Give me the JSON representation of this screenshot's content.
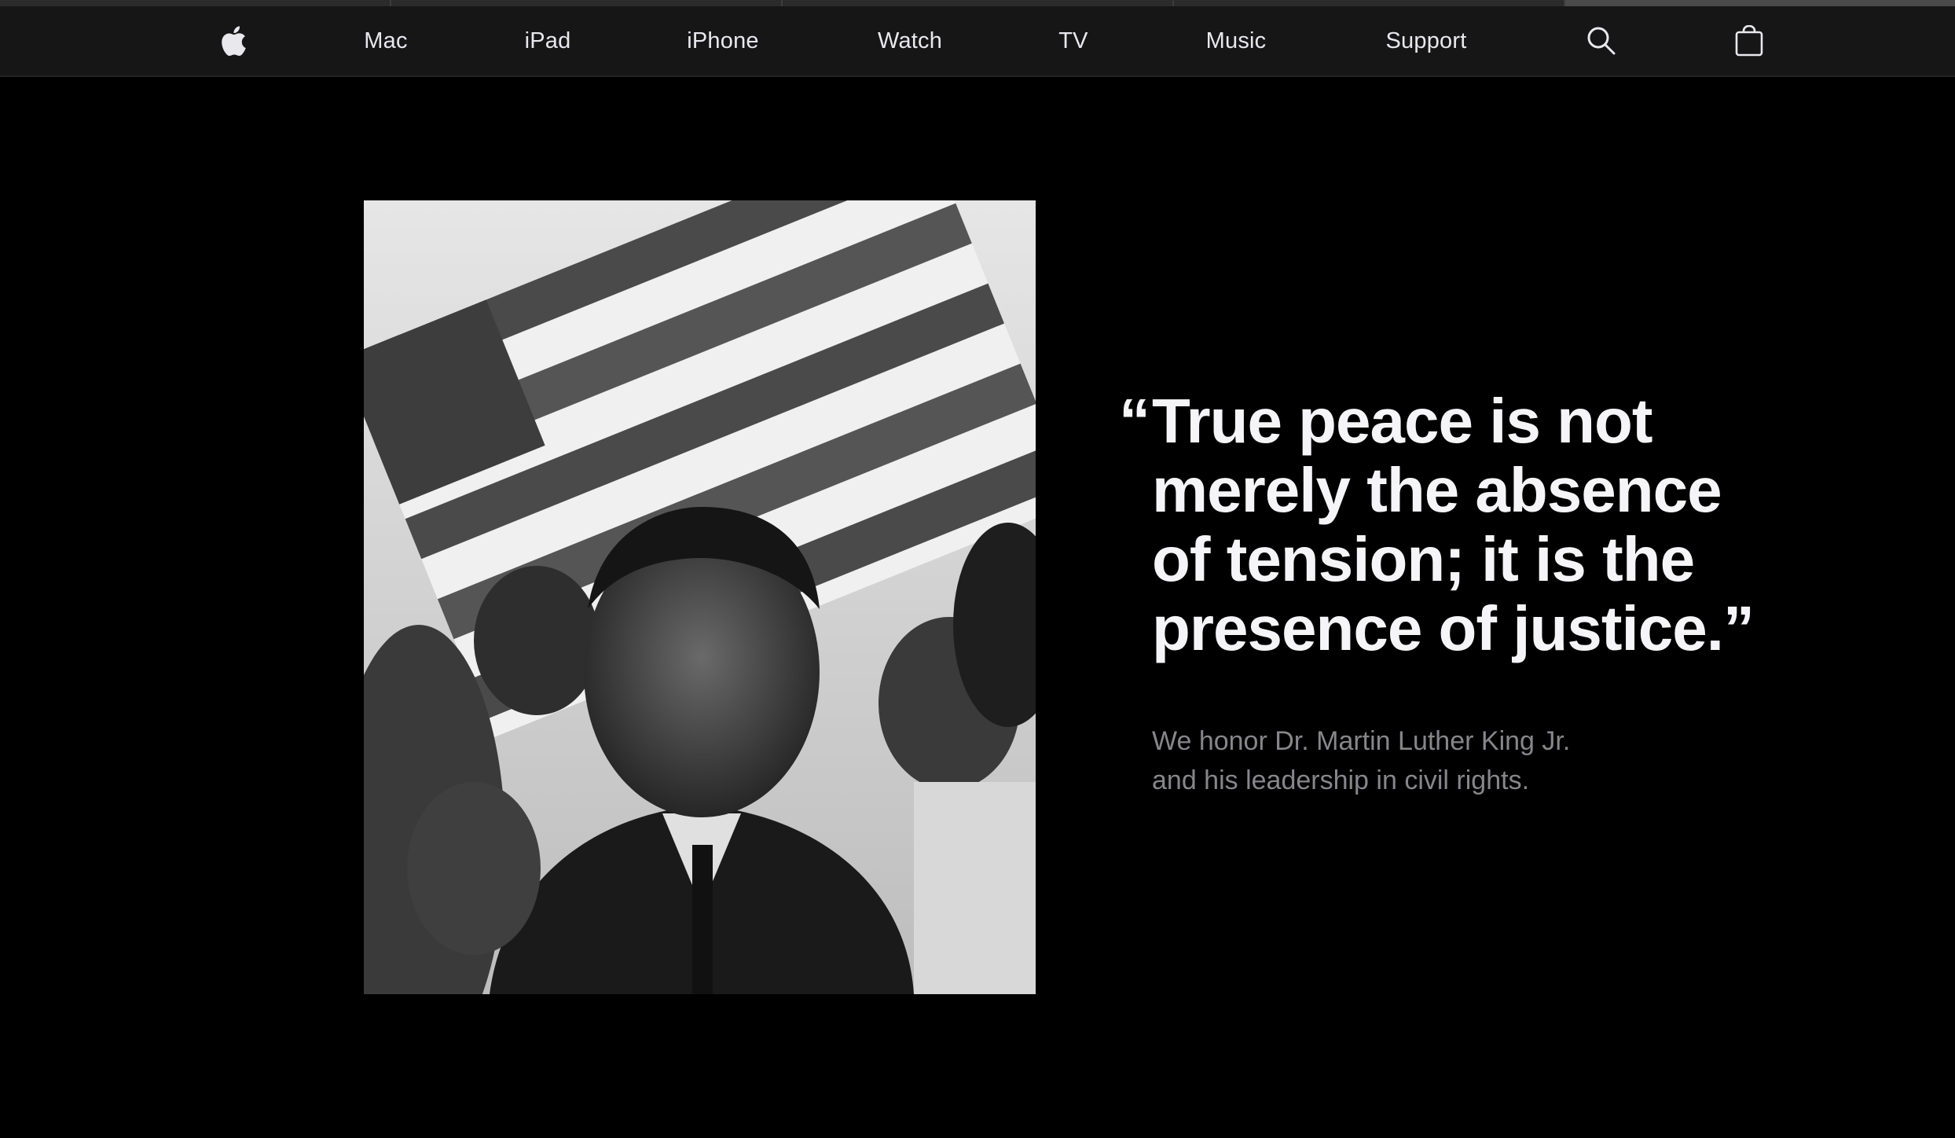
{
  "nav": {
    "items": [
      {
        "label": "Mac"
      },
      {
        "label": "iPad"
      },
      {
        "label": "iPhone"
      },
      {
        "label": "Watch"
      },
      {
        "label": "TV"
      },
      {
        "label": "Music"
      },
      {
        "label": "Support"
      }
    ],
    "icons": {
      "logo": "apple-logo-icon",
      "search": "search-icon",
      "bag": "shopping-bag-icon"
    }
  },
  "hero": {
    "quote_open": "“",
    "quote_lines": [
      "True peace is not",
      "merely the absence",
      "of tension; it is the",
      "presence of justice.”"
    ],
    "tagline_lines": [
      "We honor Dr. Martin Luther King Jr.",
      "and his leadership in civil rights."
    ]
  },
  "colors": {
    "background": "#000000",
    "nav_background": "#161617",
    "nav_text": "#e8e8ed",
    "headline": "#f5f5f7",
    "tagline": "#86868b"
  }
}
